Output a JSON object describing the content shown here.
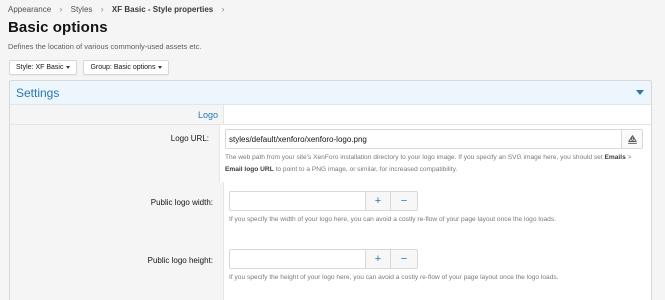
{
  "breadcrumb": [
    {
      "label": "Appearance"
    },
    {
      "label": "Styles"
    },
    {
      "label": "XF Basic - Style properties"
    }
  ],
  "page": {
    "title": "Basic options",
    "description": "Defines the location of various commonly-used assets etc."
  },
  "filters": {
    "style_label": "Style: XF Basic",
    "group_label": "Group: Basic options"
  },
  "block": {
    "title": "Settings",
    "group_label": "Logo"
  },
  "fields": {
    "logo_url": {
      "label": "Logo URL:",
      "value": "styles/default/xenforo/xenforo-logo.png",
      "explain_1": "The web path from your site's XenForo installation directory to your logo image. If you specify an SVG image here, you should set ",
      "explain_b1": "Emails",
      "explain_arrow": " > ",
      "explain_b2": "Email logo URL",
      "explain_2": " to point to a PNG image, or similar, for increased compatibility.",
      "addon_icon": "color-palette-icon"
    },
    "public_logo_width": {
      "label": "Public logo width:",
      "value": "",
      "explain": "If you specify the width of your logo here, you can avoid a costly re-flow of your page layout once the logo loads.",
      "plus": "+",
      "minus": "−"
    },
    "public_logo_height": {
      "label": "Public logo height:",
      "value": "",
      "explain": "If you specify the height of your logo here, you can avoid a costly re-flow of your page layout once the logo loads.",
      "plus": "+",
      "minus": "−"
    }
  },
  "colors": {
    "accent": "#2577b1",
    "header_bg": "#edf6fd",
    "page_bg": "#f5f5f5"
  }
}
